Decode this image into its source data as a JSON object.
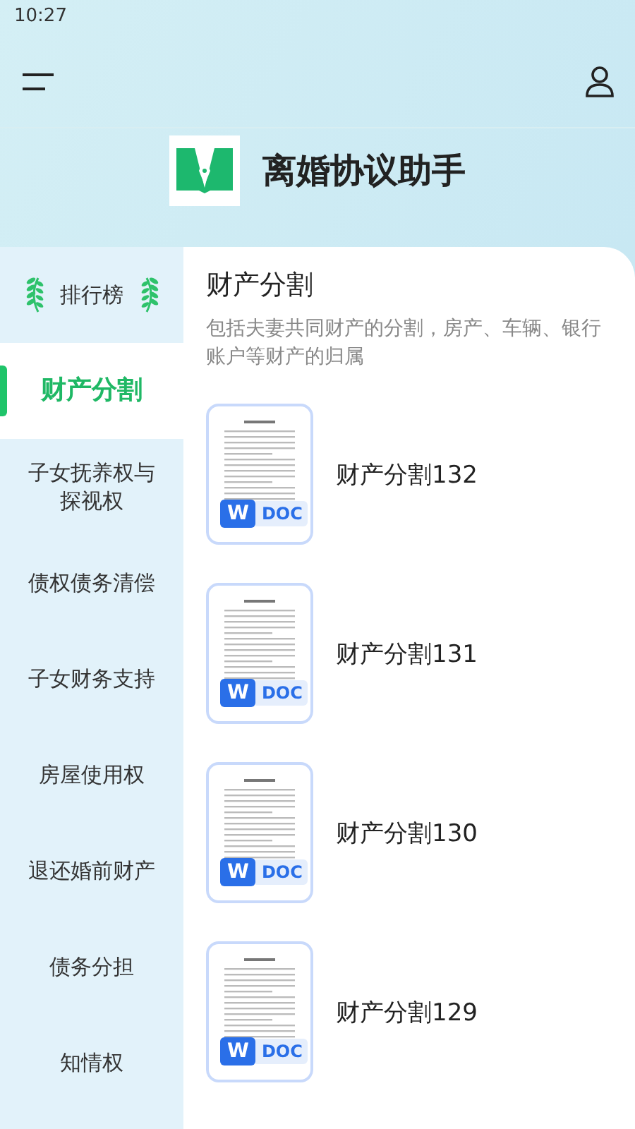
{
  "status_bar": {
    "time": "10:27"
  },
  "app": {
    "title": "离婚协议助手"
  },
  "sidebar": {
    "ranking": "排行榜",
    "items": [
      {
        "label": "财产分割",
        "selected": true
      },
      {
        "label": "子女抚养权与探视权",
        "selected": false
      },
      {
        "label": "债权债务清偿",
        "selected": false
      },
      {
        "label": "子女财务支持",
        "selected": false
      },
      {
        "label": "房屋使用权",
        "selected": false
      },
      {
        "label": "退还婚前财产",
        "selected": false
      },
      {
        "label": "债务分担",
        "selected": false
      },
      {
        "label": "知情权",
        "selected": false
      }
    ]
  },
  "content": {
    "title": "财产分割",
    "description": "包括夫妻共同财产的分割，房产、车辆、银行账户等财产的归属",
    "documents": [
      {
        "title": "财产分割132",
        "badge_letter": "W",
        "badge_type": "DOC"
      },
      {
        "title": "财产分割131",
        "badge_letter": "W",
        "badge_type": "DOC"
      },
      {
        "title": "财产分割130",
        "badge_letter": "W",
        "badge_type": "DOC"
      },
      {
        "title": "财产分割129",
        "badge_letter": "W",
        "badge_type": "DOC"
      }
    ]
  }
}
